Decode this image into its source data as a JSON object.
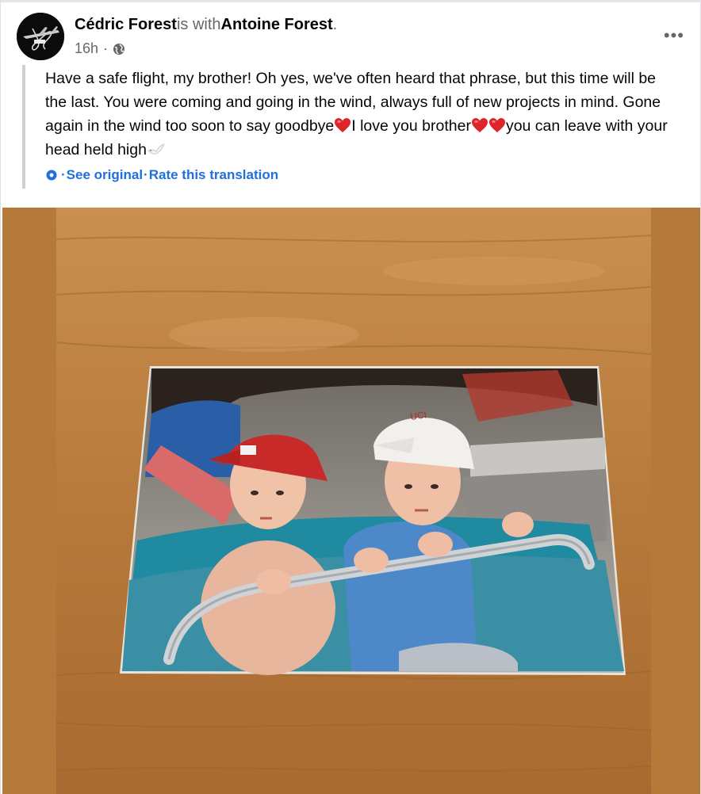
{
  "post": {
    "author": "Cédric Forest",
    "connector": "is with",
    "tagged": "Antoine Forest",
    "tagged_suffix": ".",
    "time": "16h",
    "time_separator": " · ",
    "privacy_icon": "globe-icon",
    "more_icon": "more-options-icon",
    "more_label": "•••",
    "text_parts": [
      "Have a safe flight, my brother! Oh yes, we've often heard that phrase, but this time will be the last. You were coming and going in the wind, always full of new projects in mind. Gone again in the wind too soon to say goodbye",
      "I love you brother",
      "you can leave with your head held high"
    ],
    "translation": {
      "see_original": "See original",
      "separator": "·",
      "rate": "Rate this translation"
    }
  },
  "colors": {
    "link": "#216fdb",
    "secondary_text": "#65676b",
    "heart": "#e0242b",
    "wood": "#b57a3a"
  }
}
